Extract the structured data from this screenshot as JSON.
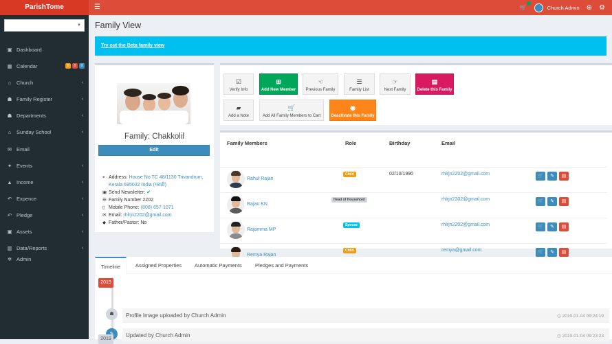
{
  "app": {
    "name": "ParishTome"
  },
  "topbar": {
    "user_name": "Church Admin"
  },
  "sidebar": {
    "items": [
      {
        "label": "Dashboard",
        "icon": "dashboard-icon",
        "glyph": "▣"
      },
      {
        "label": "Calendar",
        "icon": "calendar-icon",
        "glyph": "▦"
      },
      {
        "label": "Church",
        "icon": "church-icon",
        "glyph": "⌂"
      },
      {
        "label": "Family Register",
        "icon": "family-icon",
        "glyph": "☗"
      },
      {
        "label": "Departments",
        "icon": "users-icon",
        "glyph": "☗"
      },
      {
        "label": "Sunday School",
        "icon": "school-icon",
        "glyph": "⌂"
      },
      {
        "label": "Email",
        "icon": "email-icon",
        "glyph": "✉"
      },
      {
        "label": "Events",
        "icon": "ticket-icon",
        "glyph": "✦"
      },
      {
        "label": "Income",
        "icon": "income-icon",
        "glyph": "▲"
      },
      {
        "label": "Expence",
        "icon": "expense-icon",
        "glyph": "↶"
      },
      {
        "label": "Pledge",
        "icon": "pledge-icon",
        "glyph": "↶"
      },
      {
        "label": "Assets",
        "icon": "assets-icon",
        "glyph": "▣"
      },
      {
        "label": "Data/Reports",
        "icon": "reports-icon",
        "glyph": "▥"
      },
      {
        "label": "Admin",
        "icon": "gears-icon",
        "glyph": "✲"
      }
    ],
    "calendar_badges": [
      "0",
      "0",
      "0"
    ]
  },
  "page": {
    "title": "Family View",
    "beta_link": "Try out the Beta family view"
  },
  "family": {
    "name": "Family: Chakkolil",
    "edit_label": "Edit",
    "address_label": "Address:",
    "address": "House No TC 48/1130 Trivandrum, Kerala 695032 India (मराठी)",
    "newsletter_label": "Send Newsletter:",
    "family_number_label": "Family Number",
    "family_number": "2202",
    "mobile_label": "Mobile Phone:",
    "mobile": "(808) 657-1071",
    "email_label": "Email:",
    "email": "rhlrjn2202@gmail.com",
    "pastor_label": "Father/Pastor:",
    "pastor": "No"
  },
  "toolbar": {
    "verify": "Verify Info",
    "add_member": "Add New Member",
    "previous": "Previous Family",
    "list": "Family List",
    "next": "Next Family",
    "delete": "Delete this Family",
    "note": "Add a Note",
    "add_cart": "Add All Family Members to Cart",
    "deactivate": "Deactivate this Family"
  },
  "members": {
    "headers": {
      "members": "Family Members",
      "role": "Role",
      "birthday": "Birthday",
      "email": "Email"
    },
    "rows": [
      {
        "name": "Rahul Rajan",
        "role": "Child",
        "role_color": "#f39c12",
        "birthday": "02/10/1990",
        "email": "rhlrjn2202@gmail.com"
      },
      {
        "name": "Rajan KN",
        "role": "Head of Household",
        "role_color": "#d2d6de",
        "birthday": "",
        "email": "rhlrjn2202@gmail.com"
      },
      {
        "name": "Rajamma MP",
        "role": "Spouse",
        "role_color": "#00c0ef",
        "birthday": "",
        "email": "rhlrjn2202@gmail.com"
      },
      {
        "name": "Remya Rajan",
        "role": "Child",
        "role_color": "#f39c12",
        "birthday": "",
        "email": "remya@gmail.com"
      }
    ]
  },
  "tabs": {
    "timeline": "Timeline",
    "properties": "Assigned Properties",
    "payments": "Automatic Payments",
    "pledges": "Pledges and Payments"
  },
  "timeline": {
    "year": "2019",
    "year2": "2019",
    "items": [
      {
        "text": "Profile Image uploaded by Church Admin",
        "time": "2019-01-04 09:24:19"
      },
      {
        "text": "Updated by Church Admin",
        "time": "2019-01-04 09:23:23"
      }
    ]
  },
  "colors": {
    "brand_red": "#dd4b39",
    "sidebar": "#222d32",
    "primary": "#3c8dbc",
    "success": "#00a65a",
    "danger_pink": "#d81b60",
    "warning": "#ff851b",
    "info": "#00c0ef"
  }
}
